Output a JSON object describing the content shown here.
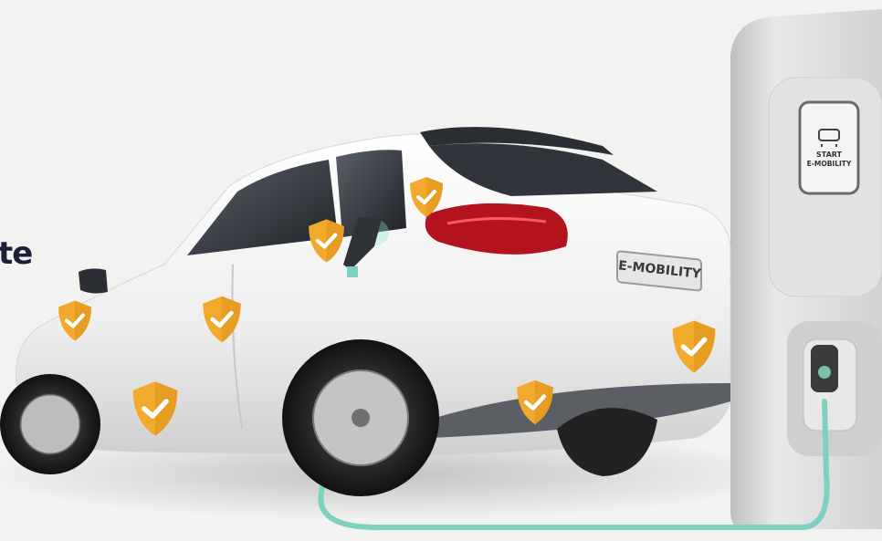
{
  "headline": {
    "visible_fragment": "te"
  },
  "car": {
    "badge_text": "E-MOBILITY",
    "color": "#ffffff"
  },
  "charger": {
    "line1": "START",
    "line2": "E-MOBILITY"
  },
  "colors": {
    "background": "#f2f2f1",
    "shield": "#f2aa2e",
    "shield_dark": "#d98f14",
    "cable": "#7fd1bf",
    "taillight": "#b3131c",
    "headline": "#1d1e3a"
  },
  "shields": [
    {
      "icon": "shield-check-icon"
    },
    {
      "icon": "shield-check-icon"
    },
    {
      "icon": "shield-check-icon"
    },
    {
      "icon": "shield-check-icon"
    },
    {
      "icon": "shield-check-icon"
    },
    {
      "icon": "shield-check-icon"
    },
    {
      "icon": "shield-check-icon"
    }
  ]
}
